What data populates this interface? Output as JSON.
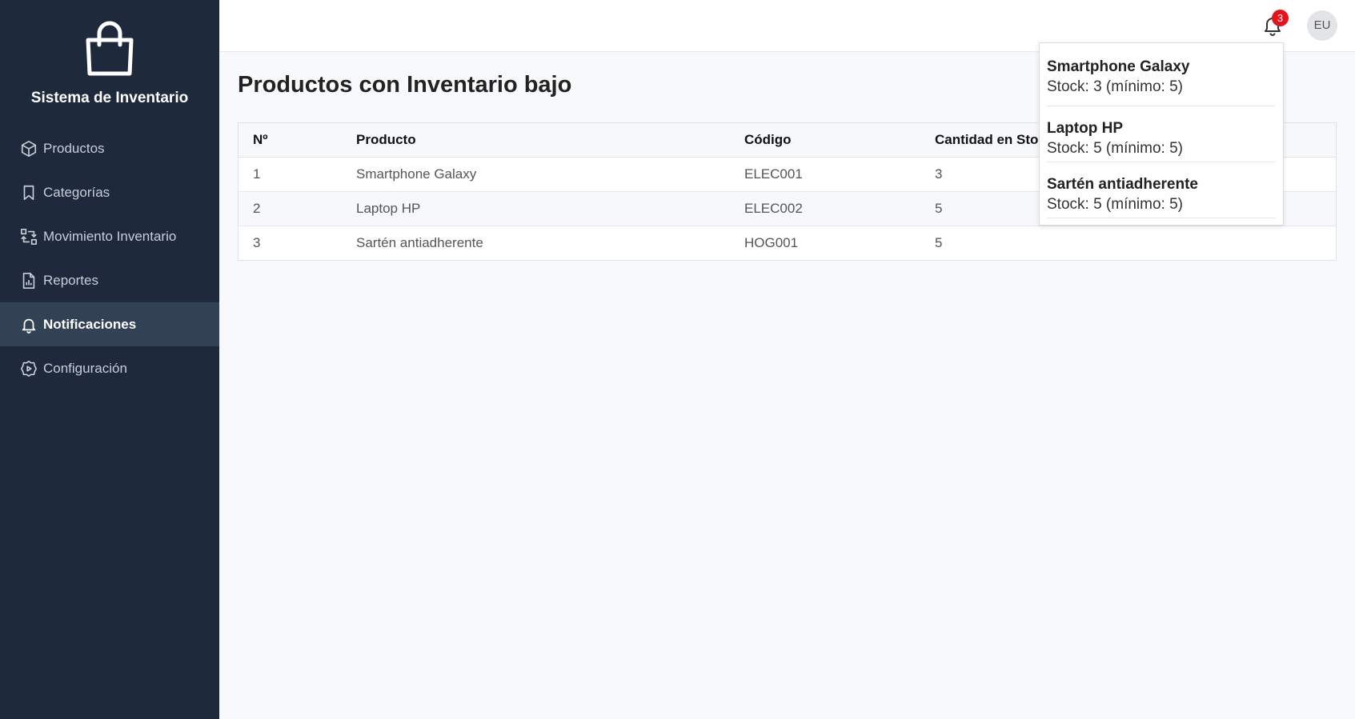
{
  "brand": {
    "title": "Sistema de Inventario"
  },
  "sidebar": {
    "items": [
      {
        "label": "Productos",
        "icon": "box-icon",
        "active": false
      },
      {
        "label": "Categorías",
        "icon": "bookmark-icon",
        "active": false
      },
      {
        "label": "Movimiento Inventario",
        "icon": "transfer-icon",
        "active": false
      },
      {
        "label": "Reportes",
        "icon": "report-icon",
        "active": false
      },
      {
        "label": "Notificaciones",
        "icon": "bell-icon",
        "active": true
      },
      {
        "label": "Configuración",
        "icon": "gear-icon",
        "active": false
      }
    ]
  },
  "header": {
    "notification_count": "3",
    "avatar_initials": "EU"
  },
  "main": {
    "title": "Productos con Inventario bajo",
    "table": {
      "columns": [
        "Nº",
        "Producto",
        "Código",
        "Cantidad en Stock"
      ],
      "rows": [
        [
          "1",
          "Smartphone Galaxy",
          "ELEC001",
          "3"
        ],
        [
          "2",
          "Laptop HP",
          "ELEC002",
          "5"
        ],
        [
          "3",
          "Sartén antiadherente",
          "HOG001",
          "5"
        ]
      ]
    }
  },
  "notifications": [
    {
      "title": "Smartphone Galaxy",
      "detail": "Stock: 3 (mínimo: 5)"
    },
    {
      "title": "Laptop HP",
      "detail": "Stock: 5 (mínimo: 5)"
    },
    {
      "title": "Sartén antiadherente",
      "detail": "Stock: 5 (mínimo: 5)"
    }
  ],
  "colors": {
    "sidebar_bg": "#1e293b",
    "sidebar_active_bg": "#334155",
    "badge": "#e3141b"
  }
}
